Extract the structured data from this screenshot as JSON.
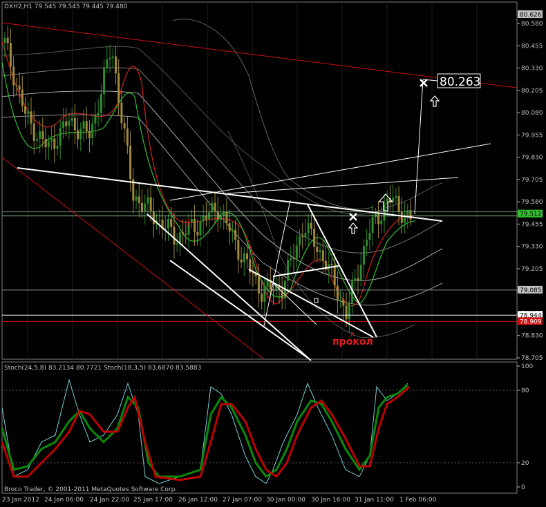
{
  "window": {
    "title": "DXH2,H1  79.545 79.545 79.445 79.480"
  },
  "colors": {
    "bg": "#000000",
    "grid": "#3a3a3a",
    "axis": "#c0c0c0",
    "trend_red": "#d01010",
    "white": "#ffffff",
    "bull": "#2e8b2e",
    "bear": "#a08a3a",
    "stoch_main": "#7ad0d8",
    "stoch_green": "#0a8a0a",
    "stoch_red": "#c00000",
    "price_green_label": "#30c030"
  },
  "price_axis": {
    "ticks": [
      "80.580",
      "80.455",
      "80.330",
      "80.205",
      "80.080",
      "79.955",
      "79.830",
      "79.705",
      "79.580",
      "79.455",
      "79.330",
      "79.205",
      "79.080",
      "78.955",
      "78.830",
      "78.705"
    ],
    "labels": {
      "top_gray": "80.626",
      "current_green": "79.512",
      "hline_gray": "79.085",
      "hline_white": "78.944",
      "hline_red": "78.909"
    }
  },
  "time_axis": {
    "ticks": [
      "23 Jan 2012",
      "24 Jan 06:00",
      "24 Jan 22:00",
      "25 Jan 17:00",
      "26 Jan 12:00",
      "27 Jan 07:00",
      "30 Jan 00:00",
      "30 Jan 16:00",
      "31 Jan 11:00",
      "1 Feb 06:00"
    ]
  },
  "annotations": {
    "target_price": "80.263",
    "prokol": "прокол"
  },
  "stoch_panel": {
    "header": "Stoch(24,5,8) 83.2134 80.7721  Stoch(18,3,5) 83.6870 83.5883",
    "levels": [
      "100",
      "80",
      "20",
      "0"
    ],
    "copyright": "Broco Trader, © 2001-2011 MetaQuotes Software Corp."
  },
  "chart_data": {
    "type": "candlestick",
    "symbol": "DXH2",
    "timeframe": "H1",
    "ohlc_last": {
      "open": 79.545,
      "high": 79.545,
      "low": 79.445,
      "close": 79.48
    },
    "ylim": [
      78.705,
      80.626
    ],
    "close_path": [
      {
        "x": "23 Jan 2012",
        "y": 80.47
      },
      {
        "x": "23 Jan 2012 +6h",
        "y": 80.05
      },
      {
        "x": "24 Jan 06:00",
        "y": 79.88
      },
      {
        "x": "24 Jan 12:00",
        "y": 80.03
      },
      {
        "x": "24 Jan 22:00",
        "y": 79.95
      },
      {
        "x": "25 Jan 04:00",
        "y": 80.45
      },
      {
        "x": "25 Jan 10:00",
        "y": 79.62
      },
      {
        "x": "25 Jan 17:00",
        "y": 79.5
      },
      {
        "x": "26 Jan 04:00",
        "y": 79.38
      },
      {
        "x": "26 Jan 12:00",
        "y": 79.45
      },
      {
        "x": "26 Jan 20:00",
        "y": 79.55
      },
      {
        "x": "27 Jan 07:00",
        "y": 79.3
      },
      {
        "x": "27 Jan 15:00",
        "y": 79.08
      },
      {
        "x": "30 Jan 00:00",
        "y": 79.1
      },
      {
        "x": "30 Jan 08:00",
        "y": 79.45
      },
      {
        "x": "30 Jan 16:00",
        "y": 79.25
      },
      {
        "x": "31 Jan 02:00",
        "y": 78.95
      },
      {
        "x": "31 Jan 11:00",
        "y": 79.4
      },
      {
        "x": "31 Jan 20:00",
        "y": 79.6
      },
      {
        "x": "1 Feb 06:00",
        "y": 79.48
      }
    ],
    "horizontal_levels": [
      79.512,
      79.085,
      78.944,
      78.909
    ],
    "stochastic": {
      "stoch_24_5_8": {
        "main": 83.2134,
        "signal": 80.7721
      },
      "stoch_18_3_5": {
        "main": 83.687,
        "signal": 83.5883
      },
      "levels": [
        80,
        20
      ]
    }
  }
}
